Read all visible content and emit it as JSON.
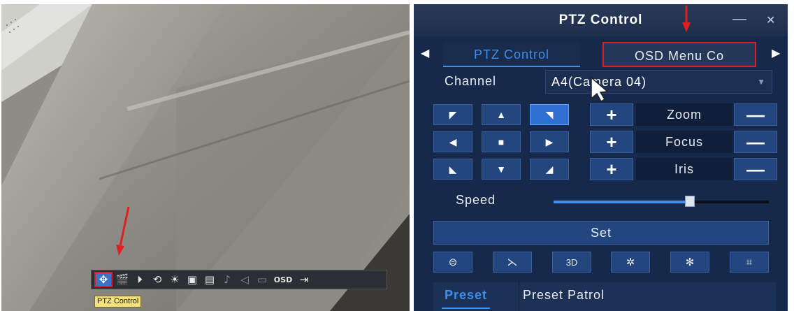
{
  "toolbar": {
    "items": [
      {
        "icon": "ptz-control-icon",
        "glyph": "✥",
        "active": true
      },
      {
        "icon": "clapperboard-icon",
        "glyph": "🎬"
      },
      {
        "icon": "playback-icon",
        "glyph": "⏵"
      },
      {
        "icon": "rotate-icon",
        "glyph": "⟲"
      },
      {
        "icon": "brightness-icon",
        "glyph": "☀"
      },
      {
        "icon": "snapshot-icon",
        "glyph": "▣"
      },
      {
        "icon": "save-icon",
        "glyph": "▤"
      },
      {
        "icon": "microphone-icon",
        "glyph": "♪",
        "dim": true
      },
      {
        "icon": "volume-icon",
        "glyph": "◁",
        "dim": true
      },
      {
        "icon": "stream-icon",
        "glyph": "▭",
        "dim": true
      },
      {
        "icon": "osd-icon",
        "glyph": "OSD"
      },
      {
        "icon": "exit-icon",
        "glyph": "⇥"
      }
    ],
    "tooltip": "PTZ Control"
  },
  "panel": {
    "title": "PTZ Control",
    "minimize_glyph": "—",
    "close_glyph": "✕",
    "tabs": {
      "left_arrow": "◀",
      "right_arrow": "▶",
      "items": [
        "PTZ Control",
        "OSD Menu Co"
      ]
    },
    "channel": {
      "label": "Channel",
      "value": "A4(Camera 04)",
      "caret": "▼"
    },
    "direction_glyphs": [
      "◤",
      "▲",
      "◥",
      "◀",
      "■",
      "▶",
      "◣",
      "▼",
      "◢"
    ],
    "lens": [
      {
        "label": "Zoom"
      },
      {
        "label": "Focus"
      },
      {
        "label": "Iris"
      }
    ],
    "plus_glyph": "+",
    "minus_glyph": "—",
    "speed": {
      "label": "Speed",
      "level": 0.64
    },
    "set_label": "Set",
    "functions": [
      {
        "icon": "wiper-icon",
        "glyph": "⊜"
      },
      {
        "icon": "light-icon",
        "glyph": "⋋"
      },
      {
        "icon": "3d-position-icon",
        "glyph": "3D"
      },
      {
        "icon": "brightness-auto-icon",
        "glyph": "✲"
      },
      {
        "icon": "snowflake-icon",
        "glyph": "✻"
      },
      {
        "icon": "zoom-area-icon",
        "glyph": "⌗"
      }
    ],
    "bottom_tabs": [
      "Preset",
      "Preset Patrol"
    ]
  },
  "colors": {
    "accent_blue": "#3d8ff0",
    "panel_bg": "#16294b",
    "highlight_red": "#e02020",
    "tooltip_yellow": "#f6e27a"
  }
}
